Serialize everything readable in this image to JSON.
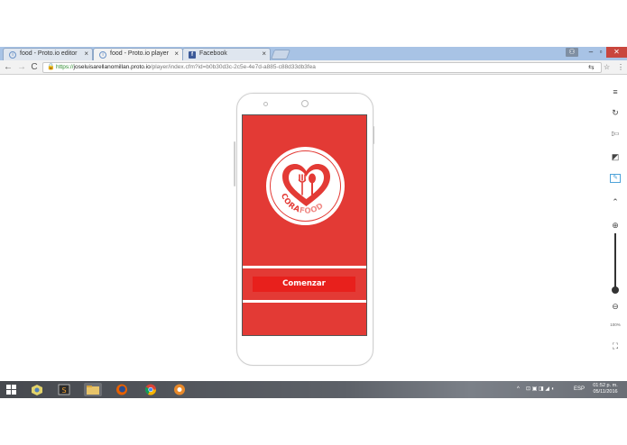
{
  "browser": {
    "tabs": [
      {
        "label": "food - Proto.io editor",
        "favicon": "protoio-icon",
        "active": false
      },
      {
        "label": "food - Proto.io player",
        "favicon": "protoio-icon",
        "active": true
      },
      {
        "label": "Facebook",
        "favicon": "facebook-icon",
        "active": false
      }
    ],
    "close_glyph": "×",
    "window_controls": {
      "user": "⚇",
      "minimize": "–",
      "maximize": "▫",
      "close": "✕"
    },
    "nav": {
      "back": "←",
      "forward": "→",
      "reload": "C"
    },
    "url": {
      "scheme": "https://",
      "host": "joseluisarellanomillan.proto.io",
      "path": "/player/index.cfm?id=b0b30d3c-2c5e-4e7d-a885-c88d33db3fea"
    },
    "menu_glyph": "⋮",
    "translate_glyph": "⇆"
  },
  "player_toolbar": {
    "tools": [
      {
        "name": "menu-icon",
        "glyph": "≡"
      },
      {
        "name": "refresh-icon",
        "glyph": "↻"
      },
      {
        "name": "rotate-device-icon",
        "glyph": "▯▭"
      },
      {
        "name": "contrast-icon",
        "glyph": "◩"
      },
      {
        "name": "edit-icon",
        "glyph": "✎"
      },
      {
        "name": "signal-icon",
        "glyph": "⌃"
      },
      {
        "name": "zoom-in-icon",
        "glyph": "⊕"
      },
      {
        "name": "zoom-out-icon",
        "glyph": "⊖"
      },
      {
        "name": "fullscreen-icon",
        "glyph": "⛶"
      }
    ],
    "zoom_level": "100%",
    "zoom_fraction": 0.95
  },
  "app": {
    "brand_first": "CORA",
    "brand_second": "FOOD",
    "start_button": "Comenzar",
    "colors": {
      "background": "#e33a35",
      "button": "#e8201c",
      "logo": "#e33a35",
      "logo_text_light": "#f08a86"
    }
  },
  "taskbar": {
    "apps": [
      "windows-start-icon",
      "camera-app-icon",
      "sublime-icon",
      "file-explorer-icon",
      "firefox-icon",
      "chrome-icon",
      "settings-gear-icon"
    ],
    "tray": {
      "chevron": "^",
      "lang": "ESP"
    },
    "time": "01:52 p. m.",
    "date": "05/11/2016"
  }
}
